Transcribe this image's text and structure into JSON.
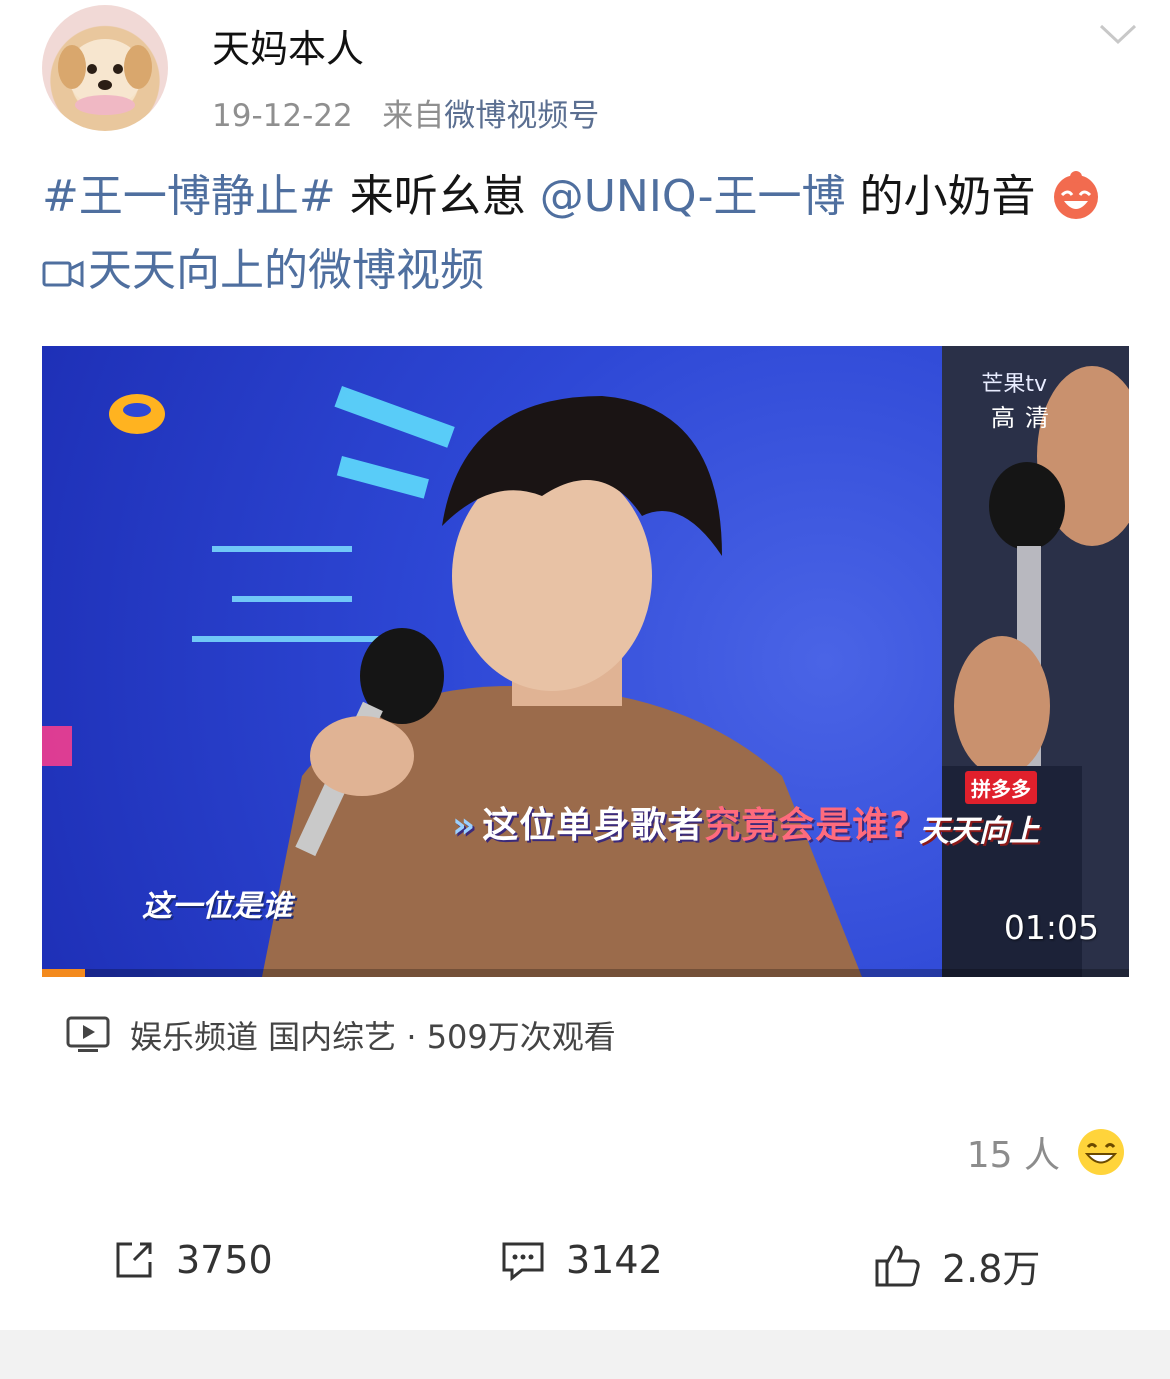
{
  "post": {
    "username": "天妈本人",
    "date": "19-12-22",
    "source_prefix": "来自",
    "source": "微博视频号",
    "hashtag": "#王一博静止#",
    "text_middle": " 来听幺崽 ",
    "mention": "@UNIQ-王一博",
    "text_after": " 的小奶音",
    "video_link": "天天向上的微博视频"
  },
  "video": {
    "duration": "01:05",
    "caption_left": "这一位是谁",
    "caption_main_part1": "这位单身歌者",
    "caption_main_part2": "究竟会是谁?",
    "tv_logo": "芒果tv",
    "hd_label": "高清",
    "brand_badge": "拼多多",
    "show_logo": "天天向上",
    "progress": 0.04
  },
  "video_info": {
    "text": "娱乐频道 国内综艺 · 509万次观看"
  },
  "reactions": {
    "count_text": "15 人"
  },
  "actions": {
    "repost": "3750",
    "comment": "3142",
    "like": "2.8万"
  },
  "colors": {
    "link": "#4f6f9f",
    "meta": "#8f8f8f",
    "progress": "#f38a1e"
  }
}
